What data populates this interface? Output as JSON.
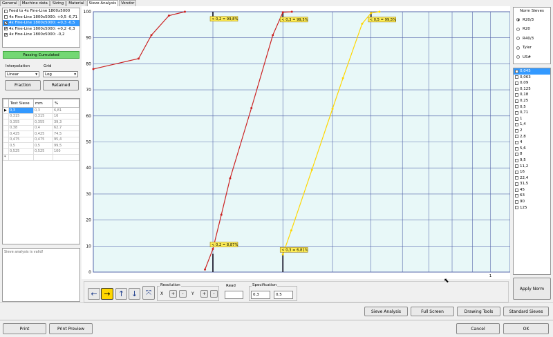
{
  "tabs": [
    {
      "label": "General"
    },
    {
      "label": "Machine data"
    },
    {
      "label": "Sizing"
    },
    {
      "label": "Material"
    },
    {
      "label": "Sieve Analysis"
    },
    {
      "label": "Vendor"
    }
  ],
  "feeds": [
    {
      "label": "Feed to 4x Fine-Line 1800x5000",
      "checked": false,
      "selected": false
    },
    {
      "label": "4x Fine-Line 1800x5000: +0,5 -0,71",
      "checked": false,
      "selected": false
    },
    {
      "label": "4x Fine-Line 1800x5000: +0,3 -0,5",
      "checked": true,
      "selected": true
    },
    {
      "label": "4x Fine-Line 1800x5000: +0,2 -0,3",
      "checked": true,
      "selected": false
    },
    {
      "label": "4x Fine-Line 1800x5000: -0,2",
      "checked": true,
      "selected": false
    }
  ],
  "passing_label": "Passing Cumulated",
  "interpolation": {
    "label": "Interpolation",
    "value": "Linear"
  },
  "grid": {
    "label": "Grid",
    "value": "Log"
  },
  "fraction_btn": "Fraction",
  "retained_btn": "Retained",
  "table": {
    "headers": [
      "Test Sieve",
      "mm",
      "%"
    ],
    "rows": [
      [
        "0,3",
        "0,3",
        "6,81"
      ],
      [
        "0,315",
        "0,315",
        "16"
      ],
      [
        "0,355",
        "0,355",
        "39,3"
      ],
      [
        "0,38",
        "0,4",
        "62,7"
      ],
      [
        "0,425",
        "0,425",
        "74,5"
      ],
      [
        "0,475",
        "0,475",
        "95,4"
      ],
      [
        "0,5",
        "0,5",
        "99,5"
      ],
      [
        "0,525",
        "0,525",
        "100"
      ]
    ],
    "row_marker": "▶",
    "new_marker": "*"
  },
  "status_text": "Sieve analysis is valid!",
  "norm": {
    "title": "Norm Sieves",
    "options": [
      {
        "label": "R20/3",
        "on": true
      },
      {
        "label": "R20",
        "on": false
      },
      {
        "label": "R40/3",
        "on": false
      },
      {
        "label": "Tyler",
        "on": false
      },
      {
        "label": "US#",
        "on": false
      }
    ]
  },
  "sieves": [
    "0,045",
    "0,063",
    "0,09",
    "0,125",
    "0,18",
    "0,25",
    "0,5",
    "0,71",
    "1",
    "1,4",
    "2",
    "2,8",
    "4",
    "5,6",
    "8",
    "9,5",
    "11,2",
    "16",
    "22,4",
    "31,5",
    "45",
    "63",
    "90",
    "125"
  ],
  "apply_norm": "Apply Norm",
  "resolution": {
    "label": "Resolution",
    "x": "X",
    "y": "Y",
    "plus": "+",
    "minus": "-"
  },
  "read": {
    "label": "Read",
    "value": ""
  },
  "specification": {
    "label": "Specification",
    "v1": "0,3",
    "v2": "0,5"
  },
  "bottom_buttons": [
    "Sieve Analysis",
    "Full Screen",
    "Drawing Tools",
    "Standard Sieves"
  ],
  "footer": {
    "print": "Print",
    "print_preview": "Print Preview",
    "cancel": "Cancel",
    "ok": "OK"
  },
  "chart_data": {
    "type": "line",
    "ylim": [
      0,
      100
    ],
    "yticks": [
      0,
      10,
      20,
      30,
      40,
      50,
      60,
      70,
      80,
      90,
      100
    ],
    "xlabel_right": "1",
    "grid": true,
    "series": [
      {
        "color": "#cc2222",
        "points": [
          [
            0.1,
            78
          ],
          [
            0.13,
            82
          ],
          [
            0.14,
            91
          ],
          [
            0.155,
            98.5
          ],
          [
            0.17,
            100
          ]
        ]
      },
      {
        "color": "#cc2222",
        "points": [
          [
            0.191,
            1
          ],
          [
            0.2,
            8.87
          ],
          [
            0.21,
            22
          ],
          [
            0.221,
            36
          ],
          [
            0.25,
            63
          ],
          [
            0.283,
            91
          ],
          [
            0.3,
            99.8
          ],
          [
            0.316,
            100
          ]
        ]
      },
      {
        "color": "#ffd700",
        "points": [
          [
            0.3,
            6.81
          ],
          [
            0.315,
            16
          ],
          [
            0.355,
            39.3
          ],
          [
            0.4,
            62.7
          ],
          [
            0.425,
            74.5
          ],
          [
            0.475,
            95.4
          ],
          [
            0.5,
            99.5
          ],
          [
            0.525,
            100
          ]
        ]
      }
    ],
    "annotations": [
      {
        "text": "< 0,2 = 99,8%",
        "x": 0.2,
        "y": 99.8
      },
      {
        "text": "< 0,3 = 99,5%",
        "x": 0.3,
        "y": 99.5
      },
      {
        "text": "< 0,5 = 99,5%",
        "x": 0.5,
        "y": 99.5
      },
      {
        "text": "< 0,2 = 8,87%",
        "x": 0.2,
        "y": 8.87
      },
      {
        "text": "< 0,3 = 6,81%",
        "x": 0.3,
        "y": 6.81
      }
    ],
    "markers": [
      0.2,
      0.3,
      0.5
    ]
  }
}
